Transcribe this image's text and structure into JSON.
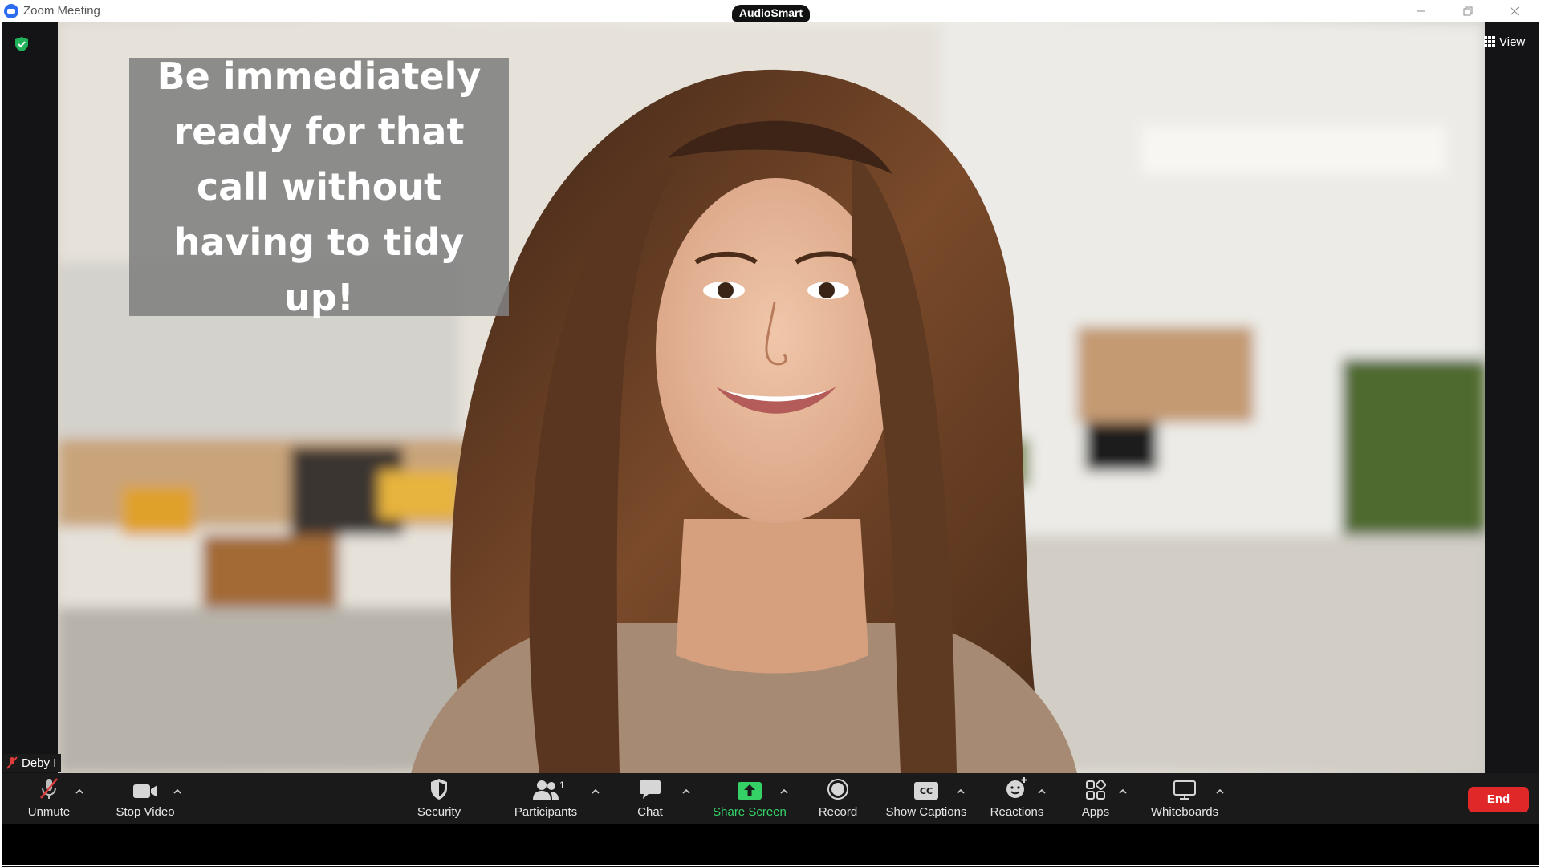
{
  "window": {
    "title": "Zoom Meeting",
    "brand_label": "AudioSmart"
  },
  "header": {
    "view_label": "View"
  },
  "video": {
    "overlay_text": "Be immediately ready for that call without having to tidy up!",
    "participant_name": "Deby I"
  },
  "toolbar": {
    "unmute": "Unmute",
    "stop_video": "Stop Video",
    "security": "Security",
    "participants": "Participants",
    "participants_count": "1",
    "chat": "Chat",
    "share_screen": "Share Screen",
    "record": "Record",
    "show_captions": "Show Captions",
    "captions_icon_text": "CC",
    "reactions": "Reactions",
    "apps": "Apps",
    "whiteboards": "Whiteboards",
    "end": "End"
  },
  "colors": {
    "share_accent": "#35d167",
    "end_red": "#e02828",
    "encryption_green": "#21b35a"
  },
  "icons": [
    "zoom-logo-icon",
    "shield-check-icon",
    "grid-icon",
    "mic-muted-icon",
    "video-camera-icon",
    "shield-icon",
    "participants-icon",
    "chat-bubble-icon",
    "share-arrow-icon",
    "record-icon",
    "cc-icon",
    "reaction-smiley-icon",
    "apps-icon",
    "whiteboard-icon",
    "chevron-up-icon"
  ]
}
